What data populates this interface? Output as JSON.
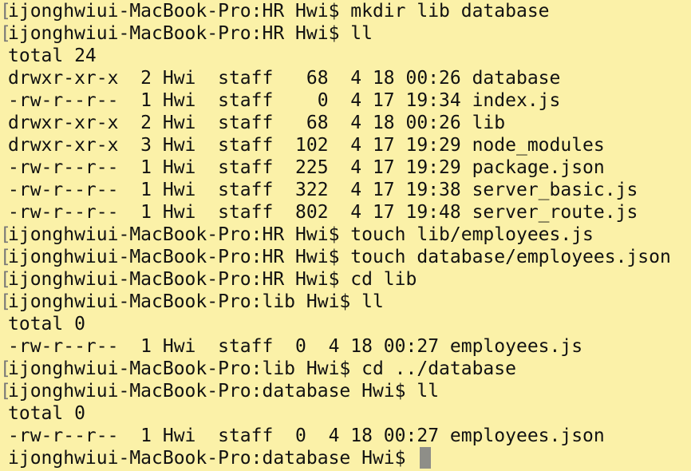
{
  "terminal": {
    "lines": [
      {
        "bracket": "[",
        "text": "ijonghwiui-MacBook-Pro:HR Hwi$ mkdir lib database"
      },
      {
        "bracket": "[",
        "text": "ijonghwiui-MacBook-Pro:HR Hwi$ ll"
      },
      {
        "bracket": "",
        "text": "total 24"
      },
      {
        "bracket": "",
        "text": "drwxr-xr-x  2 Hwi  staff   68  4 18 00:26 database"
      },
      {
        "bracket": "",
        "text": "-rw-r--r--  1 Hwi  staff    0  4 17 19:34 index.js"
      },
      {
        "bracket": "",
        "text": "drwxr-xr-x  2 Hwi  staff   68  4 18 00:26 lib"
      },
      {
        "bracket": "",
        "text": "drwxr-xr-x  3 Hwi  staff  102  4 17 19:29 node_modules"
      },
      {
        "bracket": "",
        "text": "-rw-r--r--  1 Hwi  staff  225  4 17 19:29 package.json"
      },
      {
        "bracket": "",
        "text": "-rw-r--r--  1 Hwi  staff  322  4 17 19:38 server_basic.js"
      },
      {
        "bracket": "",
        "text": "-rw-r--r--  1 Hwi  staff  802  4 17 19:48 server_route.js"
      },
      {
        "bracket": "[",
        "text": "ijonghwiui-MacBook-Pro:HR Hwi$ touch lib/employees.js"
      },
      {
        "bracket": "[",
        "text": "ijonghwiui-MacBook-Pro:HR Hwi$ touch database/employees.json"
      },
      {
        "bracket": "[",
        "text": "ijonghwiui-MacBook-Pro:HR Hwi$ cd lib"
      },
      {
        "bracket": "[",
        "text": "ijonghwiui-MacBook-Pro:lib Hwi$ ll"
      },
      {
        "bracket": "",
        "text": "total 0"
      },
      {
        "bracket": "",
        "text": "-rw-r--r--  1 Hwi  staff  0  4 18 00:27 employees.js"
      },
      {
        "bracket": "[",
        "text": "ijonghwiui-MacBook-Pro:lib Hwi$ cd ../database"
      },
      {
        "bracket": "[",
        "text": "ijonghwiui-MacBook-Pro:database Hwi$ ll"
      },
      {
        "bracket": "",
        "text": "total 0"
      },
      {
        "bracket": "",
        "text": "-rw-r--r--  1 Hwi  staff  0  4 18 00:27 employees.json"
      },
      {
        "bracket": "",
        "text": "ijonghwiui-MacBook-Pro:database Hwi$ "
      }
    ],
    "colors": {
      "background": "#fbf1a8",
      "text": "#111111",
      "cursor": "#8e8e88"
    }
  }
}
